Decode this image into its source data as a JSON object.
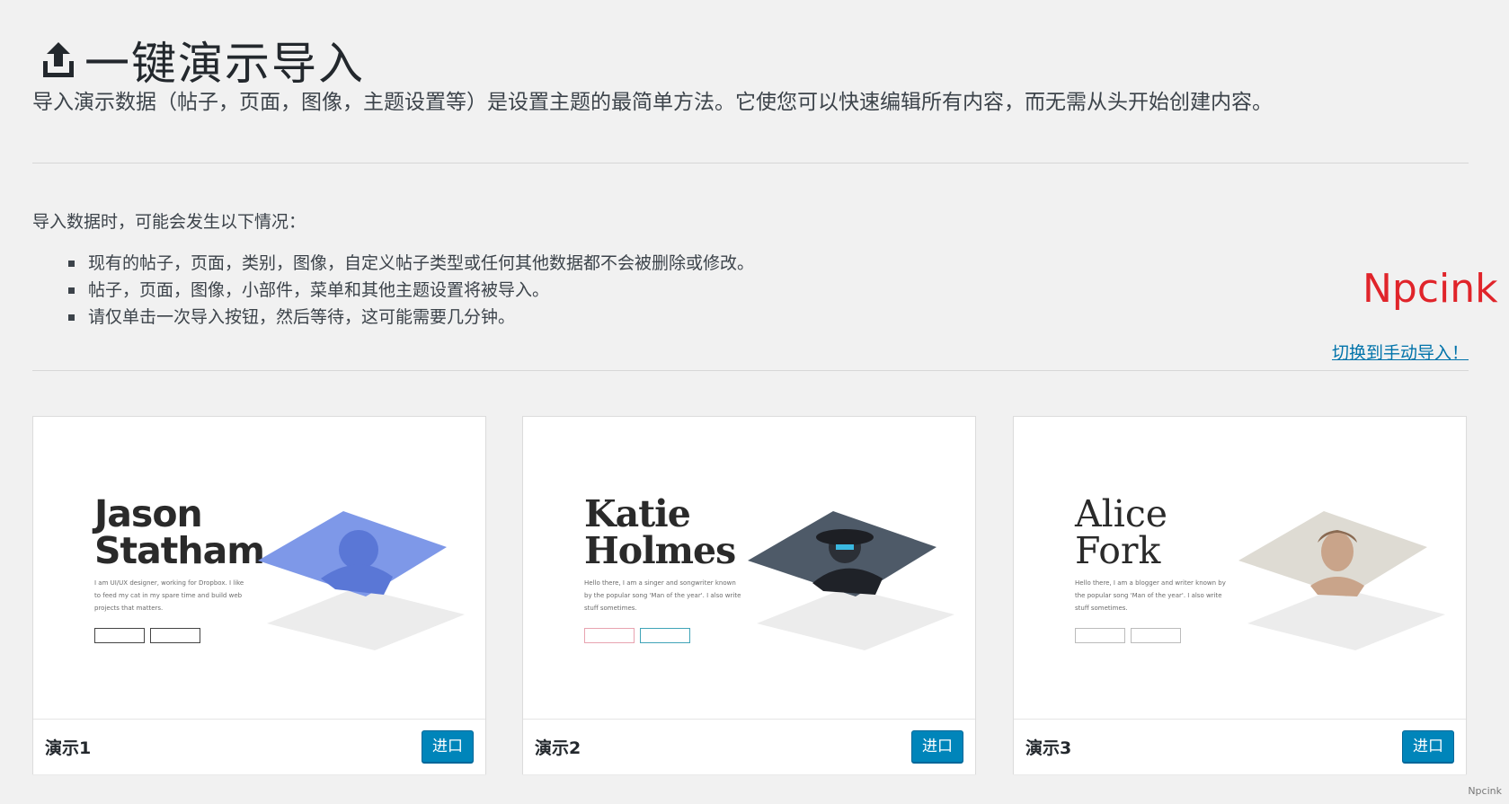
{
  "header": {
    "title": "一键演示导入",
    "icon": "upload-icon"
  },
  "intro": "导入演示数据（帖子，页面，图像，主题设置等）是设置主题的最简单方法。它使您可以快速编辑所有内容，而无需从头开始创建内容。",
  "notice": {
    "heading": "导入数据时，可能会发生以下情况：",
    "items": [
      "现有的帖子，页面，类别，图像，自定义帖子类型或任何其他数据都不会被删除或修改。",
      "帖子，页面，图像，小部件，菜单和其他主题设置将被导入。",
      "请仅单击一次导入按钮，然后等待，这可能需要几分钟。"
    ]
  },
  "watermark": "Npcink",
  "manual_link": "切换到手动导入！",
  "demos": [
    {
      "label": "演示1",
      "button": "进口",
      "preview": {
        "name_line1": "Jason",
        "name_line2": "Statham",
        "desc": "I am UI/UX designer, working for Dropbox. I like to feed my cat in my spare time and build web projects that matters."
      }
    },
    {
      "label": "演示2",
      "button": "进口",
      "preview": {
        "name_line1": "Katie",
        "name_line2": "Holmes",
        "desc": "Hello there, I am a singer and songwriter known by the popular song 'Man of the year'. I also write stuff sometimes."
      }
    },
    {
      "label": "演示3",
      "button": "进口",
      "preview": {
        "name_line1": "Alice",
        "name_line2": "Fork",
        "desc": "Hello there, I am a blogger and writer known by the popular song 'Man of the year'. I also write stuff sometimes."
      }
    }
  ],
  "footer_mark": "Npcink",
  "colors": {
    "accent": "#0085ba",
    "link": "#0073aa",
    "watermark": "#e0242a",
    "background": "#f1f1f1"
  }
}
